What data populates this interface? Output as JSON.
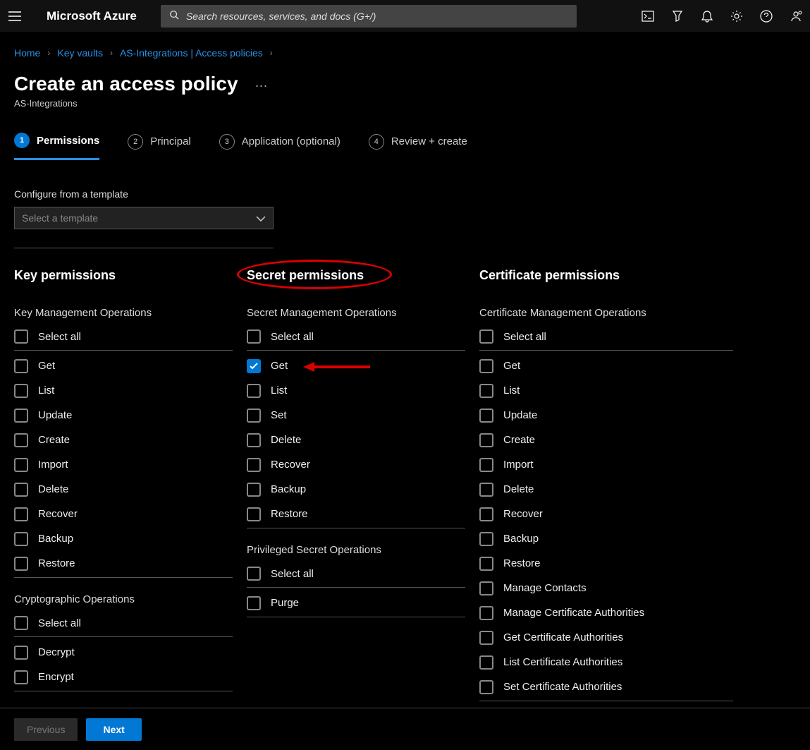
{
  "header": {
    "brand": "Microsoft Azure",
    "search_placeholder": "Search resources, services, and docs (G+/)"
  },
  "breadcrumbs": {
    "items": [
      "Home",
      "Key vaults",
      "AS-Integrations | Access policies"
    ]
  },
  "page": {
    "title": "Create an access policy",
    "subtitle": "AS-Integrations"
  },
  "tabs": {
    "items": [
      {
        "num": "1",
        "label": "Permissions",
        "active": true
      },
      {
        "num": "2",
        "label": "Principal"
      },
      {
        "num": "3",
        "label": "Application (optional)"
      },
      {
        "num": "4",
        "label": "Review + create"
      }
    ]
  },
  "template": {
    "label": "Configure from a template",
    "placeholder": "Select a template"
  },
  "columns": {
    "key": {
      "title": "Key permissions",
      "groups": [
        {
          "label": "Key Management Operations",
          "select_all": "Select all",
          "items": [
            "Get",
            "List",
            "Update",
            "Create",
            "Import",
            "Delete",
            "Recover",
            "Backup",
            "Restore"
          ]
        },
        {
          "label": "Cryptographic Operations",
          "select_all": "Select all",
          "items": [
            "Decrypt",
            "Encrypt"
          ]
        }
      ]
    },
    "secret": {
      "title": "Secret permissions",
      "groups": [
        {
          "label": "Secret Management Operations",
          "select_all": "Select all",
          "items": [
            "Get",
            "List",
            "Set",
            "Delete",
            "Recover",
            "Backup",
            "Restore"
          ],
          "checked": [
            "Get"
          ]
        },
        {
          "label": "Privileged Secret Operations",
          "select_all": "Select all",
          "items": [
            "Purge"
          ]
        }
      ]
    },
    "certificate": {
      "title": "Certificate permissions",
      "groups": [
        {
          "label": "Certificate Management Operations",
          "select_all": "Select all",
          "items": [
            "Get",
            "List",
            "Update",
            "Create",
            "Import",
            "Delete",
            "Recover",
            "Backup",
            "Restore",
            "Manage Contacts",
            "Manage Certificate Authorities",
            "Get Certificate Authorities",
            "List Certificate Authorities",
            "Set Certificate Authorities"
          ]
        }
      ]
    }
  },
  "footer": {
    "prev": "Previous",
    "next": "Next"
  }
}
